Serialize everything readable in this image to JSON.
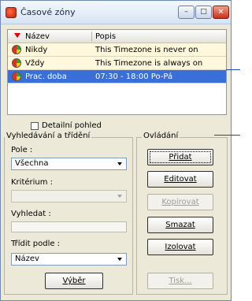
{
  "window": {
    "title": "Časové zóny",
    "minimize": "–",
    "maximize": "□",
    "close": "×"
  },
  "table": {
    "columns": [
      "Název",
      "Popis"
    ],
    "rows": [
      {
        "name": "Nikdy",
        "desc": "This Timezone is never on"
      },
      {
        "name": "Vždy",
        "desc": "This Timezone is always on"
      },
      {
        "name": "Prac. doba",
        "desc": "07:30 - 18:00 Po-Pá"
      }
    ]
  },
  "detail_checkbox": {
    "label": "Detailní pohled",
    "checked": false
  },
  "search": {
    "legend": "Vyhledávání a třídění",
    "field_label": "Pole :",
    "field_value": "Všechna",
    "criterion_label": "Kritérium :",
    "criterion_value": "",
    "find_label": "Vyhledat :",
    "find_value": "",
    "sort_label": "Třídit podle :",
    "sort_value": "Název",
    "select_button": "Výběr"
  },
  "controls": {
    "legend": "Ovládání",
    "add": "Přidat",
    "edit": "Editovat",
    "copy": "Kopírovat",
    "delete": "Smazat",
    "isolate": "Izolovat",
    "print": "Tisk..."
  }
}
